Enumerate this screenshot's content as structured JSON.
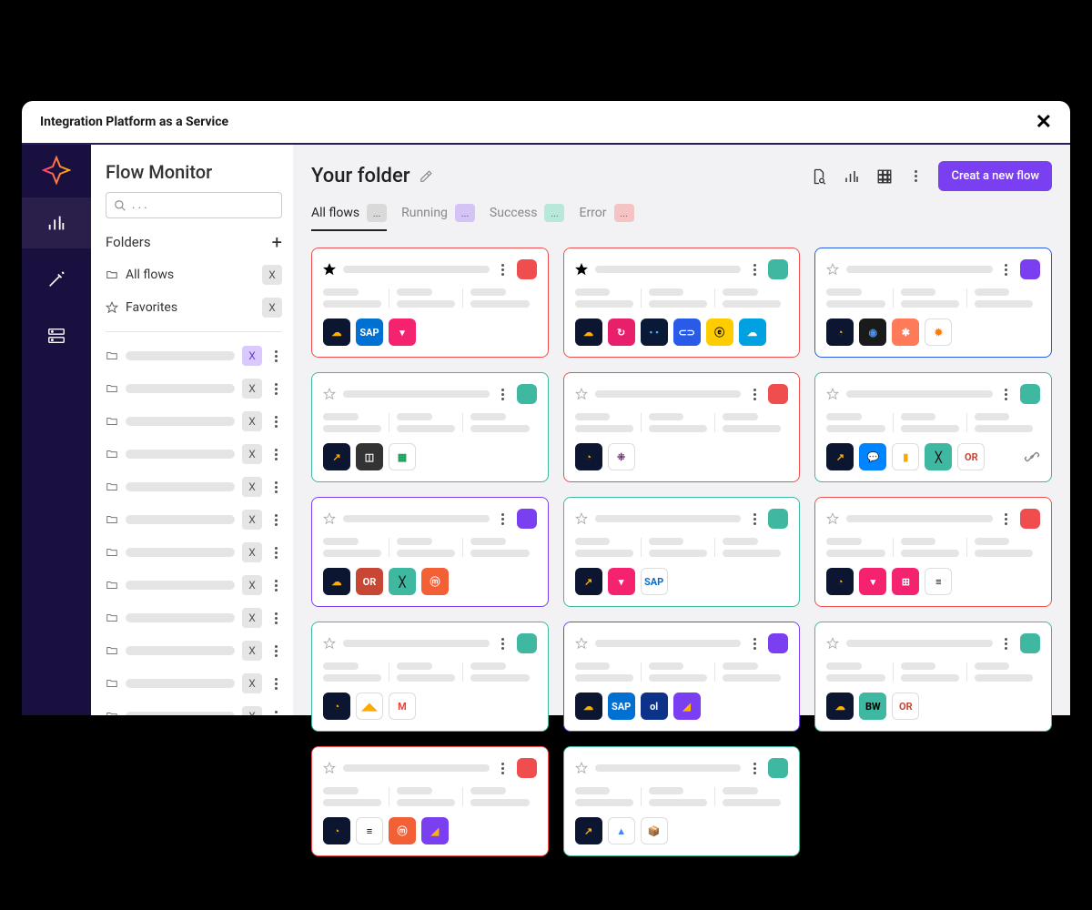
{
  "app_title": "Integration Platform as a Service",
  "sidebar": {
    "heading": "Flow Monitor",
    "search_placeholder": ". . .",
    "folders_label": "Folders",
    "items": [
      {
        "label": "All flows",
        "badge": "X",
        "badge_style": "gray"
      },
      {
        "label": "Favorites",
        "badge": "X",
        "badge_style": "gray"
      }
    ],
    "sub_folders_badge": "X"
  },
  "main": {
    "title": "Your folder",
    "new_flow_label": "Creat a new flow"
  },
  "tabs": [
    {
      "label": "All flows",
      "chip": "...",
      "chip_class": "chip-gray",
      "active": true
    },
    {
      "label": "Running",
      "chip": "...",
      "chip_class": "chip-purple",
      "active": false
    },
    {
      "label": "Success",
      "chip": "...",
      "chip_class": "chip-green",
      "active": false
    },
    {
      "label": "Error",
      "chip": "...",
      "chip_class": "chip-red",
      "active": false
    }
  ],
  "cards": [
    {
      "border": "bord-red",
      "fav": true,
      "status": "sq-red",
      "icons": [
        {
          "bg": "#0c1630",
          "txt": "☁",
          "fg": "#ffb100"
        },
        {
          "bg": "#0070d2",
          "txt": "SAP",
          "fg": "#fff"
        },
        {
          "bg": "#f5236f",
          "txt": "▾",
          "fg": "#fff"
        }
      ]
    },
    {
      "border": "bord-red",
      "fav": true,
      "status": "sq-green",
      "icons": [
        {
          "bg": "#0c1630",
          "txt": "☁",
          "fg": "#ffb100"
        },
        {
          "bg": "#e8206b",
          "txt": "↻",
          "fg": "#fff"
        },
        {
          "bg": "#0a1a36",
          "txt": "• •",
          "fg": "#4da6ff"
        },
        {
          "bg": "#2a5be8",
          "txt": "⊂⊃",
          "fg": "#fff"
        },
        {
          "bg": "#ffcc00",
          "txt": "ⓔ",
          "fg": "#000"
        },
        {
          "bg": "#00a1e0",
          "txt": "☁",
          "fg": "#fff"
        }
      ]
    },
    {
      "border": "bord-blue",
      "fav": false,
      "status": "sq-purple",
      "icons": [
        {
          "bg": "#0c1630",
          "txt": "◔",
          "fg": "#ffb100"
        },
        {
          "bg": "#1a1a1a",
          "txt": "◉",
          "fg": "#4a90e2"
        },
        {
          "bg": "#ff7a59",
          "txt": "✱",
          "fg": "#fff"
        },
        {
          "bg": "#fff",
          "txt": "✹",
          "fg": "#ff7a00",
          "border": "1px solid #ddd"
        }
      ]
    },
    {
      "border": "bord-green",
      "fav": false,
      "status": "sq-green",
      "icons": [
        {
          "bg": "#0c1630",
          "txt": "↗",
          "fg": "#ffb100"
        },
        {
          "bg": "#333",
          "txt": "◫",
          "fg": "#fff"
        },
        {
          "bg": "#fff",
          "txt": "▦",
          "fg": "#0f9d58",
          "border": "1px solid #ddd"
        }
      ]
    },
    {
      "border": "bord-red",
      "fav": false,
      "status": "sq-red",
      "icons": [
        {
          "bg": "#0c1630",
          "txt": "◔",
          "fg": "#ffb100"
        },
        {
          "bg": "#fff",
          "txt": "⁜",
          "fg": "#4a154b",
          "border": "1px solid #ddd"
        }
      ]
    },
    {
      "border": "bord-green",
      "fav": false,
      "status": "sq-green",
      "link": true,
      "icons": [
        {
          "bg": "#0c1630",
          "txt": "↗",
          "fg": "#ffb100"
        },
        {
          "bg": "#0084ff",
          "txt": "💬",
          "fg": "#fff"
        },
        {
          "bg": "#fff",
          "txt": "▮",
          "fg": "#f9ab00",
          "border": "1px solid #ddd"
        },
        {
          "bg": "#3eb8a0",
          "txt": "╳",
          "fg": "#1a1a1a"
        },
        {
          "bg": "#fff",
          "txt": "OR",
          "fg": "#c74634",
          "border": "1px solid #ddd"
        }
      ]
    },
    {
      "border": "bord-purple",
      "fav": false,
      "status": "sq-purple",
      "icons": [
        {
          "bg": "#0c1630",
          "txt": "☁",
          "fg": "#ffb100"
        },
        {
          "bg": "#c74634",
          "txt": "OR",
          "fg": "#fff"
        },
        {
          "bg": "#3eb8a0",
          "txt": "╳",
          "fg": "#1a1a1a"
        },
        {
          "bg": "#f46036",
          "txt": "ⓜ",
          "fg": "#fff"
        }
      ]
    },
    {
      "border": "bord-green",
      "fav": false,
      "status": "sq-green",
      "icons": [
        {
          "bg": "#0c1630",
          "txt": "↗",
          "fg": "#ffb100"
        },
        {
          "bg": "#f5236f",
          "txt": "▾",
          "fg": "#fff"
        },
        {
          "bg": "#fff",
          "txt": "SAP",
          "fg": "#0070d2",
          "border": "1px solid #ddd"
        }
      ]
    },
    {
      "border": "bord-red",
      "fav": false,
      "status": "sq-red",
      "icons": [
        {
          "bg": "#0c1630",
          "txt": "◔",
          "fg": "#ffb100"
        },
        {
          "bg": "#f5236f",
          "txt": "▾",
          "fg": "#fff"
        },
        {
          "bg": "#f5236f",
          "txt": "⊞",
          "fg": "#fff"
        },
        {
          "bg": "#fff",
          "txt": "≡",
          "fg": "#000",
          "border": "1px solid #ddd"
        }
      ]
    },
    {
      "border": "bord-green",
      "fav": false,
      "status": "sq-green",
      "icons": [
        {
          "bg": "#0c1630",
          "txt": "◔",
          "fg": "#ffb100"
        },
        {
          "bg": "#fff",
          "txt": "◢◣",
          "fg": "#f9ab00",
          "border": "1px solid #ddd"
        },
        {
          "bg": "#fff",
          "txt": "M",
          "fg": "#ea4335",
          "border": "1px solid #ddd"
        }
      ]
    },
    {
      "border": "bord-purple",
      "fav": false,
      "status": "sq-purple",
      "icons": [
        {
          "bg": "#0c1630",
          "txt": "☁",
          "fg": "#ffb100"
        },
        {
          "bg": "#0070d2",
          "txt": "SAP",
          "fg": "#fff"
        },
        {
          "bg": "#0c3389",
          "txt": "ol",
          "fg": "#fff"
        },
        {
          "bg": "#7b3ff2",
          "txt": "◢",
          "fg": "#ffb100"
        }
      ]
    },
    {
      "border": "bord-green",
      "fav": false,
      "status": "sq-green",
      "icons": [
        {
          "bg": "#0c1630",
          "txt": "☁",
          "fg": "#ffb100"
        },
        {
          "bg": "#3eb8a0",
          "txt": "BW",
          "fg": "#000"
        },
        {
          "bg": "#fff",
          "txt": "OR",
          "fg": "#c74634",
          "border": "1px solid #ddd"
        }
      ]
    },
    {
      "border": "bord-red",
      "fav": false,
      "status": "sq-red",
      "icons": [
        {
          "bg": "#0c1630",
          "txt": "◔",
          "fg": "#ffb100"
        },
        {
          "bg": "#fff",
          "txt": "≡",
          "fg": "#000",
          "border": "1px solid #ddd"
        },
        {
          "bg": "#f46036",
          "txt": "ⓜ",
          "fg": "#fff"
        },
        {
          "bg": "#7b3ff2",
          "txt": "◢",
          "fg": "#ffb100"
        }
      ]
    },
    {
      "border": "bord-green",
      "fav": false,
      "status": "sq-green",
      "icons": [
        {
          "bg": "#0c1630",
          "txt": "↗",
          "fg": "#ffb100"
        },
        {
          "bg": "#fff",
          "txt": "▲",
          "fg": "#4285f4",
          "border": "1px solid #ddd"
        },
        {
          "bg": "#fff",
          "txt": "📦",
          "fg": "#c07c40",
          "border": "1px solid #ddd"
        }
      ]
    }
  ]
}
